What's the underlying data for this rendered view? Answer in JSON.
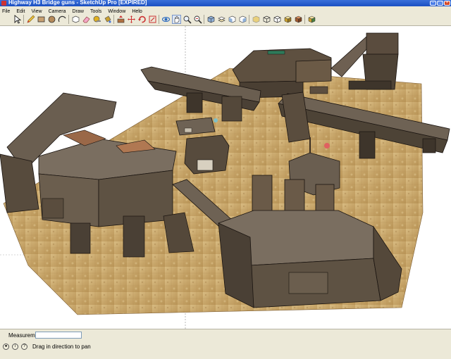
{
  "window": {
    "title": "Highway H3 Bridge guns - SketchUp Pro [EXPIRED]",
    "minimize_glyph": "–",
    "maximize_glyph": "□",
    "close_glyph": "×"
  },
  "menu": {
    "items": [
      {
        "label": "File"
      },
      {
        "label": "Edit"
      },
      {
        "label": "View"
      },
      {
        "label": "Camera"
      },
      {
        "label": "Draw"
      },
      {
        "label": "Tools"
      },
      {
        "label": "Window"
      },
      {
        "label": "Help"
      }
    ]
  },
  "toolbar": {
    "tools": [
      "select-tool",
      "eraser-tool",
      "pencil-tool",
      "rectangle-tool",
      "circle-tool",
      "arc-tool",
      "push-pull-tool",
      "paint-bucket-tool",
      "tape-measure-tool",
      "move-tool",
      "follow-me-tool",
      "rotate-tool",
      "offset-tool",
      "orbit-tool",
      "pan-tool",
      "zoom-tool",
      "zoom-extents-tool",
      "previous-view-tool",
      "iso-view",
      "top-view",
      "front-view",
      "right-view",
      "back-view",
      "left-view",
      "xray-style",
      "wireframe-style",
      "hidden-line-style",
      "shaded-style",
      "textured-style",
      "monochrome-style",
      "section-tool",
      "components-tool",
      "materials-tool"
    ]
  },
  "statusbar": {
    "measurements_label": "Measurements",
    "measurements_value": "",
    "status_text": "Drag in direction to pan",
    "icons": [
      "geo-location-icon",
      "credits-icon",
      "help-icon"
    ]
  },
  "colors": {
    "titlebar": "#1a4fc2",
    "chrome": "#ece9d8",
    "ground": "#c8a46a",
    "structure": "#6a5a45"
  }
}
